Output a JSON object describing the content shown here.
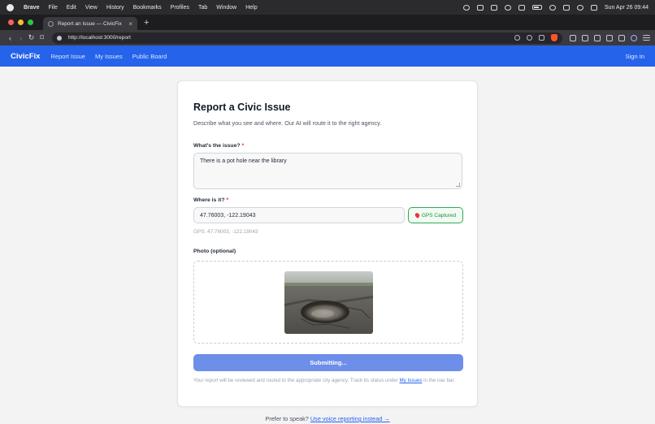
{
  "menubar": {
    "app_name": "Brave",
    "items": [
      "File",
      "Edit",
      "View",
      "History",
      "Bookmarks",
      "Profiles",
      "Tab",
      "Window",
      "Help"
    ],
    "clock": "Sun Apr 26  09:44"
  },
  "browser": {
    "tab_title": "Report an Issue — CivicFix",
    "tab_close": "×",
    "new_tab": "+",
    "url": "http://localhost:3000/report"
  },
  "app_nav": {
    "brand": "CivicFix",
    "links": [
      "Report Issue",
      "My Issues",
      "Public Board"
    ],
    "sign_in": "Sign In"
  },
  "form": {
    "title": "Report a Civic Issue",
    "subtitle": "Describe what you see and where. Our AI will route it to the right agency.",
    "issue_label": "What's the issue?",
    "required_mark": "*",
    "issue_value": "There is a pot hole near the library",
    "location_label": "Where is it?",
    "location_value": "47.76003, -122.19043",
    "gps_button": "GPS Captured",
    "gps_readout": "GPS: 47.76003, -122.19043",
    "photo_label": "Photo (optional)",
    "submit_label": "Submitting...",
    "footnote_before": "Your report will be reviewed and routed to the appropriate city agency. Track its status under ",
    "footnote_link": "My Issues",
    "footnote_after": " in the nav bar."
  },
  "voice": {
    "prompt": "Prefer to speak?",
    "link": "Use voice reporting instead →"
  },
  "colors": {
    "accent": "#2563eb",
    "submit_disabled": "#6d8ee9",
    "gps_success": "#34a853",
    "required": "#dc2626"
  }
}
